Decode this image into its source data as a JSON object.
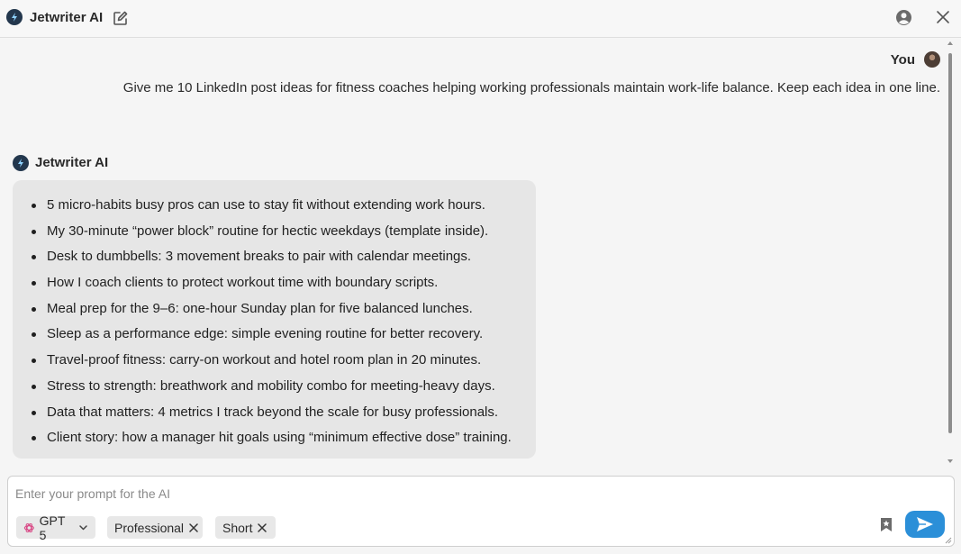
{
  "app": {
    "title": "Jetwriter AI",
    "icons": {
      "logo": "lightning-bolt-logo",
      "new_chat": "edit-square-icon",
      "account": "user-circle-icon",
      "close": "close-icon"
    }
  },
  "chat": {
    "user": {
      "label": "You",
      "message": "Give me 10 LinkedIn post ideas for fitness coaches helping working professionals maintain work-life balance. Keep each idea in one line."
    },
    "assistant": {
      "label": "Jetwriter AI",
      "items": [
        "5 micro-habits busy pros can use to stay fit without extending work hours.",
        "My 30-minute “power block” routine for hectic weekdays (template inside).",
        "Desk to dumbbells: 3 movement breaks to pair with calendar meetings.",
        "How I coach clients to protect workout time with boundary scripts.",
        "Meal prep for the 9–6: one-hour Sunday plan for five balanced lunches.",
        "Sleep as a performance edge: simple evening routine for better recovery.",
        "Travel-proof fitness: carry-on workout and hotel room plan in 20 minutes.",
        "Stress to strength: breathwork and mobility combo for meeting-heavy days.",
        "Data that matters: 4 metrics I track beyond the scale for busy professionals.",
        "Client story: how a manager hit goals using “minimum effective dose” training."
      ]
    }
  },
  "composer": {
    "placeholder": "Enter your prompt for the AI",
    "model": "GPT 5",
    "tone": "Professional",
    "length": "Short",
    "icons": {
      "model": "openai-icon",
      "model_dropdown": "chevron-down-icon",
      "remove": "close-icon",
      "save": "bookmark-icon",
      "send": "send-icon"
    }
  },
  "colors": {
    "accent": "#2b8fd8",
    "logo_bg": "#23374d",
    "bubble_bg": "#e6e6e6",
    "chip_bg": "#e8e8e8",
    "openai_icon": "#d94b87"
  }
}
